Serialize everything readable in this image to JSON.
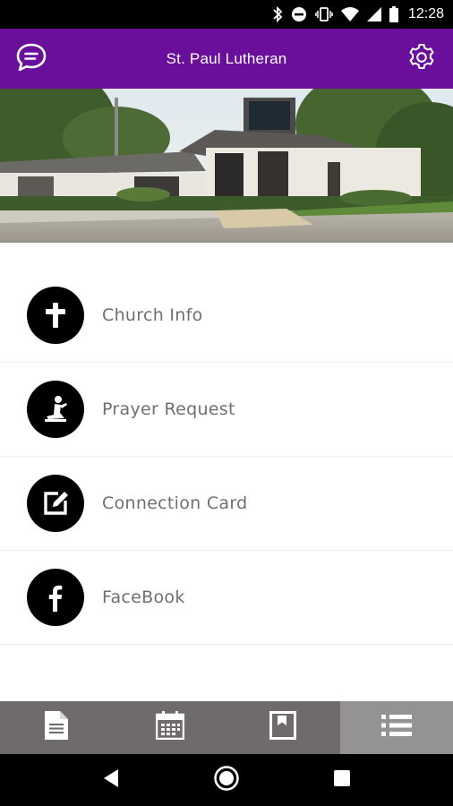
{
  "status_bar": {
    "time": "12:28",
    "icons": [
      "bluetooth-icon",
      "do-not-disturb-icon",
      "vibrate-icon",
      "wifi-icon",
      "cell-signal-icon",
      "battery-icon"
    ]
  },
  "app_bar": {
    "title": "St. Paul Lutheran",
    "left_icon": "chat-bubble-icon",
    "right_icon": "gear-icon",
    "color": "#6a0e9c"
  },
  "hero": {
    "icon": "church-building-photo"
  },
  "menu": {
    "items": [
      {
        "label": "Church Info",
        "icon": "cross-icon"
      },
      {
        "label": "Prayer Request",
        "icon": "praying-person-icon"
      },
      {
        "label": "Connection Card",
        "icon": "edit-card-icon"
      },
      {
        "label": "FaceBook",
        "icon": "facebook-icon"
      }
    ]
  },
  "tab_bar": {
    "tabs": [
      {
        "icon": "document-icon",
        "active": false
      },
      {
        "icon": "calendar-icon",
        "active": false
      },
      {
        "icon": "bulletin-icon",
        "active": false
      },
      {
        "icon": "list-icon",
        "active": true
      }
    ],
    "color": "#6e6a6d",
    "active_color": "#959295"
  },
  "nav_bar": {
    "buttons": [
      "back-icon",
      "home-icon",
      "recents-icon"
    ]
  }
}
